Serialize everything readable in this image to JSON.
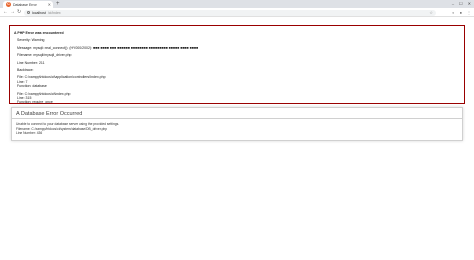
{
  "browser": {
    "tab_title": "Database Error",
    "tab_favicon": "C",
    "url_host": "localhost",
    "url_path": "/ci/index",
    "colors": {
      "tab_strip": "#dee1e6",
      "error_border": "#990000"
    }
  },
  "php_error": {
    "heading": "A PHP Error was encountered",
    "severity": "Severity: Warning",
    "message": "Message: mysqli::real_connect(): (HY000/2002): ■■■ ■■■■ ■■■ ■■■■■■ ■■■■■■■■ ■■■■■■■■■ ■■■■■ ■■■■ ■■■■",
    "filename": "Filename: mysqli/mysqli_driver.php",
    "line_number": "Line Number: 211",
    "backtrace_label": "Backtrace:",
    "backtrace": [
      {
        "file": "File: C:\\xampp\\htdocs\\ci\\application\\controllers\\Index.php",
        "line": "Line: 7",
        "function": "Function: database"
      },
      {
        "file": "File: C:\\xampp\\htdocs\\ci\\index.php",
        "line": "Line: 315",
        "function": "Function: require_once"
      }
    ]
  },
  "db_error": {
    "title": "A Database Error Occurred",
    "message": "Unable to connect to your database server using the provided settings.",
    "filename": "Filename: C:/xampp/htdocs/ci/system/database/DB_driver.php",
    "line_number": "Line Number: 436"
  }
}
